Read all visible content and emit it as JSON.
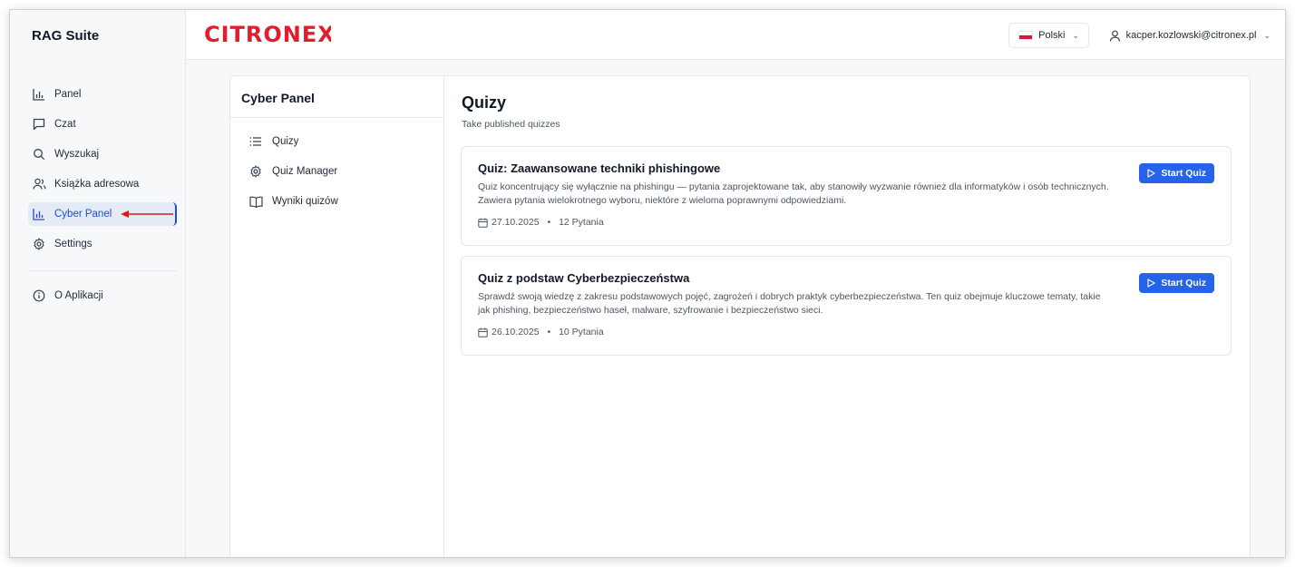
{
  "app": {
    "name": "RAG Suite"
  },
  "sidebar": {
    "items": [
      {
        "label": "Panel",
        "icon": "bar-chart-icon"
      },
      {
        "label": "Czat",
        "icon": "chat-icon"
      },
      {
        "label": "Wyszukaj",
        "icon": "search-icon"
      },
      {
        "label": "Książka adresowa",
        "icon": "contacts-icon"
      },
      {
        "label": "Cyber Panel",
        "icon": "bar-chart-icon",
        "active": true
      },
      {
        "label": "Settings",
        "icon": "gear-icon"
      }
    ],
    "footer": {
      "label": "O Aplikacji",
      "icon": "info-icon"
    }
  },
  "header": {
    "brand": "CITRONEX",
    "language": "Polski",
    "user_email": "kacper.kozlowski@citronex.pl"
  },
  "sub_sidebar": {
    "title": "Cyber Panel",
    "items": [
      {
        "label": "Quizy",
        "icon": "list-icon"
      },
      {
        "label": "Quiz Manager",
        "icon": "gear-icon"
      },
      {
        "label": "Wyniki quizów",
        "icon": "book-icon"
      }
    ]
  },
  "main": {
    "title": "Quizy",
    "subtitle": "Take published quizzes",
    "quizzes": [
      {
        "title": "Quiz: Zaawansowane techniki phishingowe",
        "description": "Quiz koncentrujący się wyłącznie na phishingu — pytania zaprojektowane tak, aby stanowiły wyzwanie również dla informatyków i osób technicznych. Zawiera pytania wielokrotnego wyboru, niektóre z wieloma poprawnymi odpowiedziami.",
        "date": "27.10.2025",
        "questions": "12 Pytania",
        "button": "Start Quiz"
      },
      {
        "title": "Quiz z podstaw Cyberbezpieczeństwa",
        "description": "Sprawdź swoją wiedzę z zakresu podstawowych pojęć, zagrożeń i dobrych praktyk cyberbezpieczeństwa. Ten quiz obejmuje kluczowe tematy, takie jak phishing, bezpieczeństwo haseł, malware, szyfrowanie i bezpieczeństwo sieci.",
        "date": "26.10.2025",
        "questions": "10 Pytania",
        "button": "Start Quiz"
      }
    ]
  },
  "colors": {
    "accent": "#2563eb",
    "brand": "#e11d2e",
    "arrow": "#d91c1c"
  }
}
